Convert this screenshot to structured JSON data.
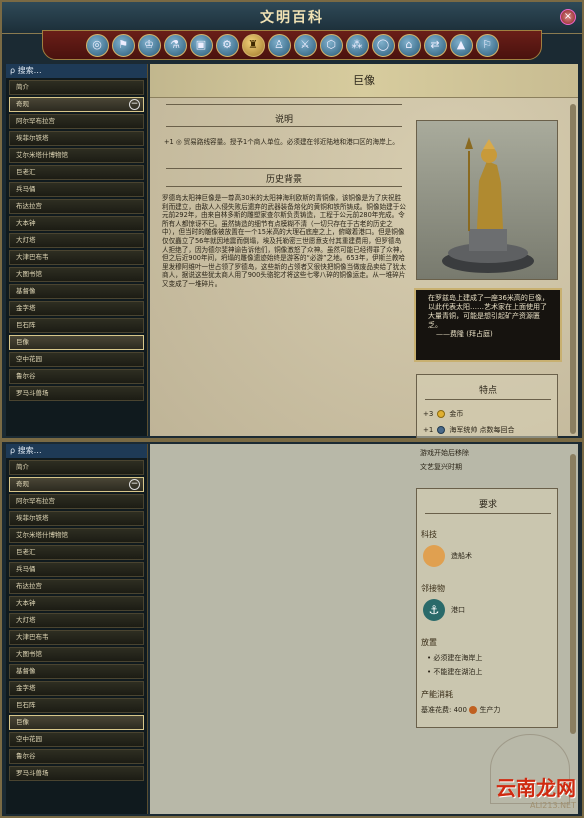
{
  "window": {
    "title": "文明百科",
    "close_glyph": "×"
  },
  "categories": [
    {
      "icon": "world-globe-icon",
      "glyph": "◎"
    },
    {
      "icon": "flag-icon",
      "glyph": "⚑"
    },
    {
      "icon": "bust-icon",
      "glyph": "♔"
    },
    {
      "icon": "flask-icon",
      "glyph": "⚗"
    },
    {
      "icon": "cube-icon",
      "glyph": "▣"
    },
    {
      "icon": "gear-icon",
      "glyph": "⚙"
    },
    {
      "icon": "wonder-icon",
      "glyph": "♜",
      "active": true
    },
    {
      "icon": "person-icon",
      "glyph": "♙"
    },
    {
      "icon": "swords-icon",
      "glyph": "⚔"
    },
    {
      "icon": "hex-icon",
      "glyph": "⬡"
    },
    {
      "icon": "dots-icon",
      "glyph": "⁂"
    },
    {
      "icon": "oval-icon",
      "glyph": "◯"
    },
    {
      "icon": "temple-icon",
      "glyph": "⌂"
    },
    {
      "icon": "arrows-icon",
      "glyph": "⇄"
    },
    {
      "icon": "mountain-icon",
      "glyph": "▲"
    },
    {
      "icon": "flag2-icon",
      "glyph": "⚐"
    }
  ],
  "sidebar": {
    "search_label": "ρ 搜索…",
    "items": [
      "简介",
      "奇观",
      "阿尔罕布拉宫",
      "埃菲尔铁塔",
      "艾尔米塔什博物馆",
      "巨老汇",
      "兵马俑",
      "布达拉宫",
      "大本钟",
      "大灯塔",
      "大津巴布韦",
      "大图书馆",
      "基督像",
      "金字塔",
      "巨石阵",
      "巨像",
      "空中花园",
      "鲁尔谷",
      "罗马斗兽场"
    ],
    "selected_top": "巨像",
    "collapse_glyph": "−"
  },
  "article": {
    "title": "巨像",
    "section_desc": "说明",
    "desc_text": "+1 ◎ 贸易路线容量。授予1个商人单位。必须建在邻近陆地和港口区的海岸上。",
    "section_history": "历史背景",
    "history_text": "罗德岛太阳神巨像是一尊高30米的太阳神海利欧斯的青铜像，该铜像是为了庆祝胜利而建立，由敌人入侵失败后遗弃的武器装备熔化的黄铜和铁所铸成。铜像始建于公元前292年，由来自林多斯的雕塑家查尔斯负责铸造，工程于公元前280年完成。令所有人都惊讶不已。虽然铸造的细节有点模糊不清（一切只存在于古老的历史之中），但当时的雕像被放置在一个15米高的大理石底座之上，俯瞰着港口。但是铜像仅仅矗立了56年就因地震而倒塌，埃及托勒密三世愿意支付其重建费用，但罗德岛人拒绝了，因为德尔斐神谕告诉他们，铜像激怒了众神。虽然可能已经得罪了众神，但之后近900年间，坍塌的雕像遗迹始终是游客的“必游”之地。653年，伊斯兰教哈里发穆阿维叶一世占领了罗德岛，这些新的占领者又很快把铜像当做废品卖给了犹太商人，据说这些犹太商人用了900头骆驼才将这些七零八碎的铜像运走。从一堆碎片又变成了一堆碎片。",
    "quote": "在罗兹岛上建成了一座36米高的巨像，以此代表太阳……艺术家在上面使用了大量青铜，可能是想引起矿产资源匮乏。",
    "quote_author": "——费隆 (拜占庭)",
    "features_title": "特点",
    "features": [
      {
        "icon": "gold-coin-icon",
        "text": "+3",
        "unit": "金币"
      },
      {
        "icon": "trade-icon",
        "text": "+1",
        "unit": "海军统帅 点数每回合"
      }
    ]
  },
  "requirements": {
    "removed_title": "游戏开始后移除",
    "removed_value": "文艺复兴时期",
    "title": "要求",
    "tech_label": "科技",
    "tech_item": "造船术",
    "district_label": "邻接物",
    "district_item": "港口",
    "placement_label": "放置",
    "placement": [
      "必须建在海岸上",
      "不能建在湖泊上"
    ],
    "cost_label": "产能消耗",
    "cost_text": "基准花费:",
    "cost_value": "400",
    "cost_unit": "生产力"
  },
  "watermark": {
    "cn": "云南龙网",
    "en": "ALI213.NET"
  },
  "colors": {
    "accent": "#d4b36a",
    "window_bg": "#1b2a33",
    "parchment": "#cfc5a8",
    "selection": "#d8c78a"
  }
}
